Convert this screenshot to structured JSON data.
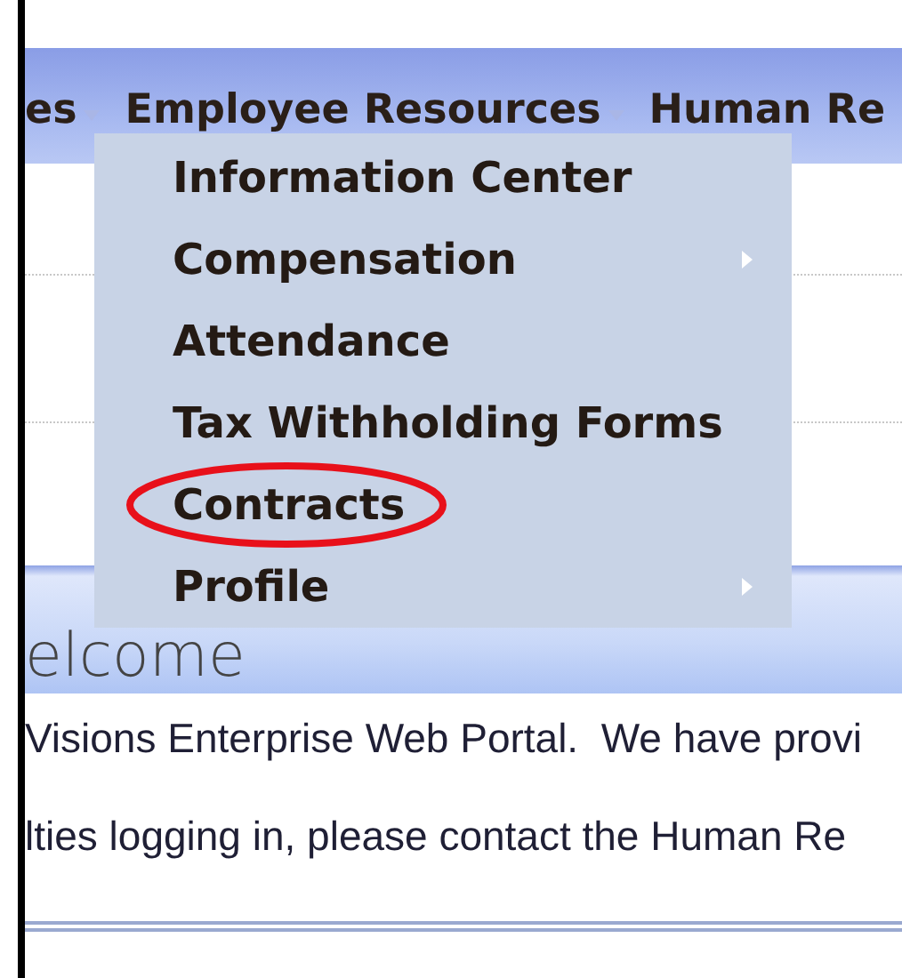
{
  "nav": [
    {
      "label": "es",
      "dropdown": true
    },
    {
      "label": "Employee Resources",
      "dropdown": true
    },
    {
      "label": "Human Re",
      "dropdown": false
    }
  ],
  "menu": [
    {
      "label": "Information Center",
      "submenu": false,
      "circled": false
    },
    {
      "label": "Compensation",
      "submenu": true,
      "circled": false
    },
    {
      "label": "Attendance",
      "submenu": false,
      "circled": false
    },
    {
      "label": "Tax Withholding Forms",
      "submenu": false,
      "circled": false
    },
    {
      "label": "Contracts",
      "submenu": false,
      "circled": true
    },
    {
      "label": "Profile",
      "submenu": true,
      "circled": false
    }
  ],
  "welcome": {
    "title": "elcome",
    "lines": [
      "Visions Enterprise Web Portal.  We have provi",
      "lties logging in, please contact the Human Re"
    ]
  }
}
